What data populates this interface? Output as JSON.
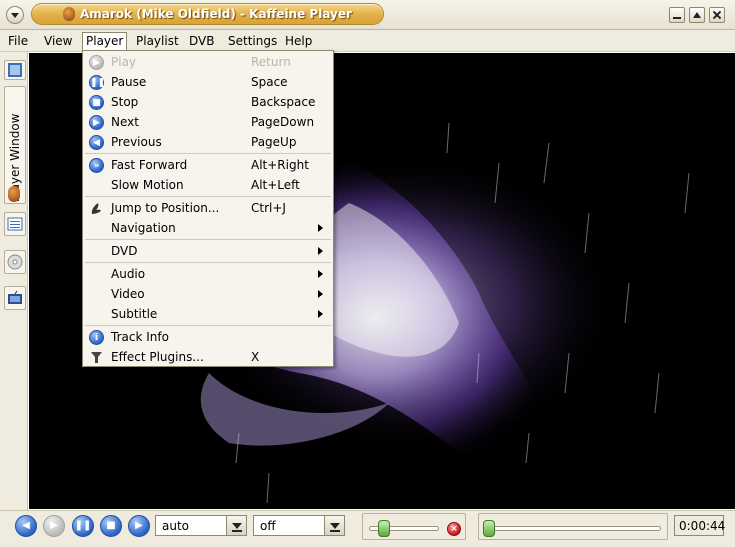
{
  "window": {
    "title": "Amarok (Mike Oldfield) - Kaffeine Player"
  },
  "menubar": {
    "items": [
      "File",
      "View",
      "Player",
      "Playlist",
      "DVB",
      "Settings",
      "Help"
    ],
    "active": "Player"
  },
  "sidebar": {
    "tab_label": "Player Window",
    "icons": [
      "kaffeine-start-icon",
      "kaffeine-logo-icon",
      "playlist-icon",
      "disc-icon",
      "dvb-icon"
    ]
  },
  "player_menu": {
    "items": [
      {
        "label": "Play",
        "shortcut": "Return",
        "disabled": true,
        "icon": "play-icon"
      },
      {
        "label": "Pause",
        "shortcut": "Space",
        "icon": "pause-icon"
      },
      {
        "label": "Stop",
        "shortcut": "Backspace",
        "icon": "stop-icon"
      },
      {
        "label": "Next",
        "shortcut": "PageDown",
        "icon": "next-icon"
      },
      {
        "label": "Previous",
        "shortcut": "PageUp",
        "icon": "previous-icon"
      },
      {
        "label": "Fast Forward",
        "shortcut": "Alt+Right",
        "icon": "fast-forward-icon"
      },
      {
        "label": "Slow Motion",
        "shortcut": "Alt+Left"
      },
      {
        "label": "Jump to Position...",
        "shortcut": "Ctrl+J",
        "icon": "jump-icon"
      },
      {
        "label": "Navigation",
        "submenu": true
      },
      {
        "label": "DVD",
        "submenu": true
      },
      {
        "label": "Audio",
        "submenu": true
      },
      {
        "label": "Video",
        "submenu": true
      },
      {
        "label": "Subtitle",
        "submenu": true
      },
      {
        "label": "Track Info",
        "icon": "info-icon"
      },
      {
        "label": "Effect Plugins...",
        "shortcut": "X",
        "icon": "funnel-icon"
      }
    ]
  },
  "toolbar": {
    "audio_combo_value": "auto",
    "subtitle_combo_value": "off",
    "volume_level": 0.15,
    "position_level": 0.0,
    "time": "0:00:44"
  },
  "colors": {
    "title_accent": "#e2b048",
    "menu_icon_blue": "#2c63c9",
    "slider_green": "#5fa83e",
    "mute_red": "#c41b1b",
    "visualization_purple": "#8a5fd0"
  }
}
